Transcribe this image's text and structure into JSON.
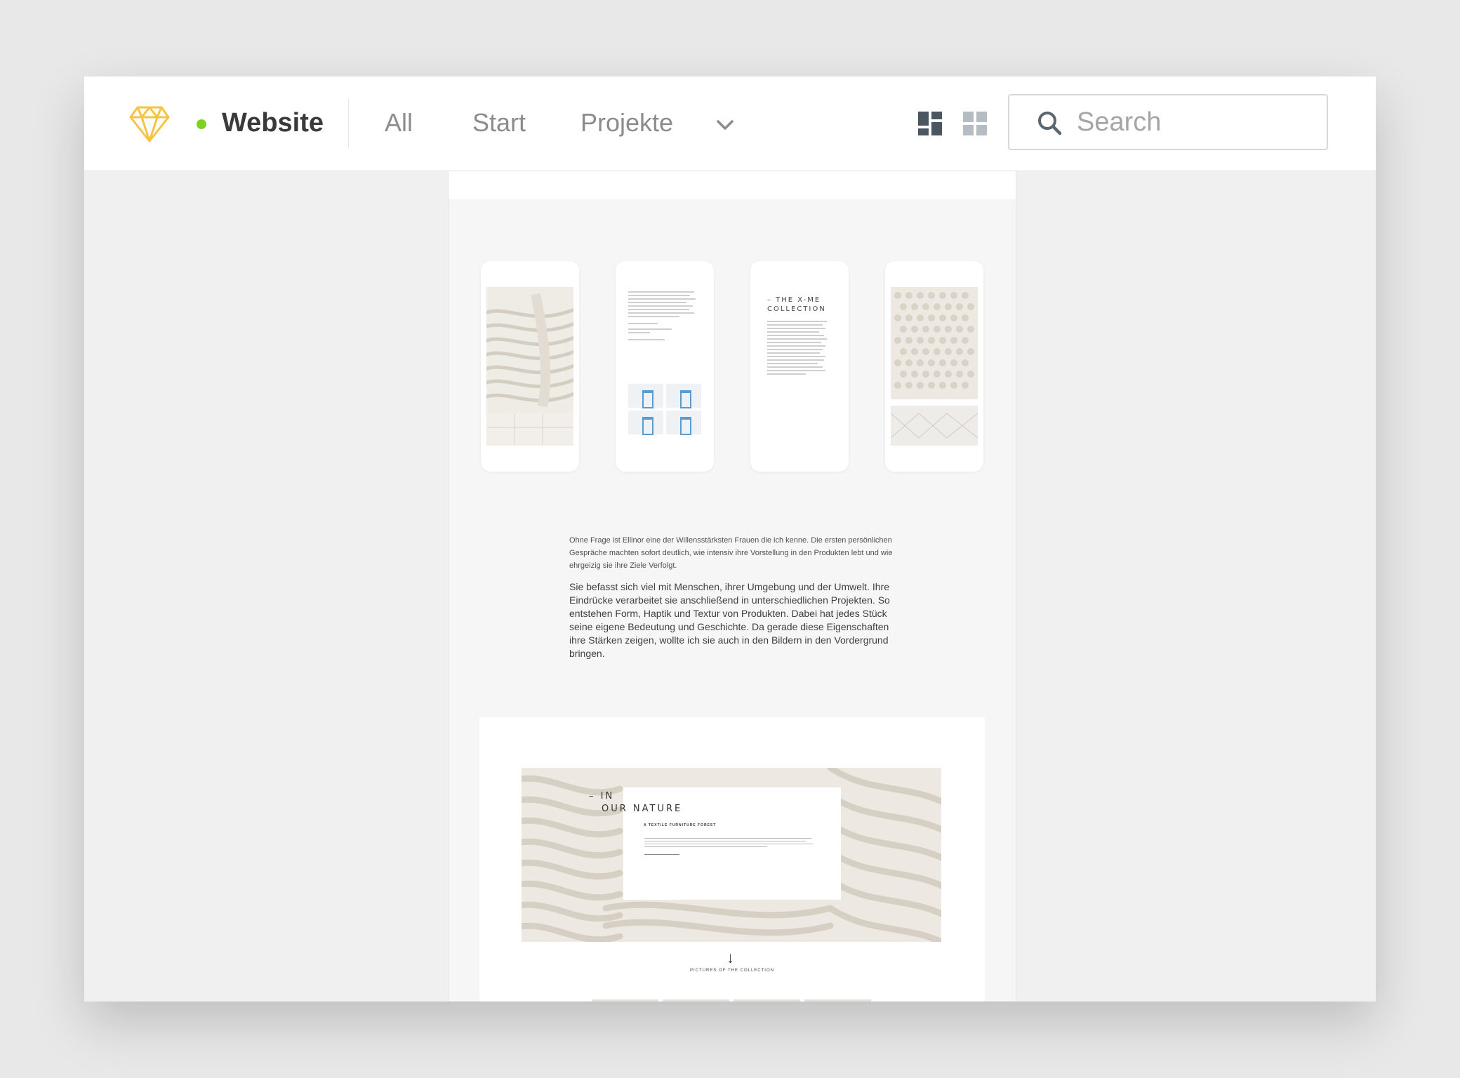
{
  "app": {
    "project_name": "Website",
    "status_color": "#7ed321",
    "logo_icon": "sketch-diamond-icon",
    "accent_color": "#f6c343"
  },
  "nav": {
    "tabs": [
      {
        "label": "All"
      },
      {
        "label": "Start"
      },
      {
        "label": "Projekte"
      }
    ],
    "more_icon": "chevron-down-icon"
  },
  "view_toggle": {
    "layout_icon": "dashboard-layout-icon",
    "grid_icon": "grid-icon"
  },
  "search": {
    "placeholder": "Search",
    "icon": "search-icon"
  },
  "preview": {
    "phone_3_title": "– THE X-ME COLLECTION",
    "intro_small": "Ohne Frage ist Ellinor eine der Willensstärksten Frauen die ich kenne. Die ersten persönlichen Gespräche machten sofort deutlich, wie intensiv ihre Vorstellung in den Produkten lebt und wie ehrgeizig sie ihre Ziele Verfolgt.",
    "intro_large": "Sie befasst sich viel mit Menschen, ihrer Umgebung und der Umwelt. Ihre Eindrücke verarbeitet sie anschließend in unterschiedlichen Projekten. So entstehen Form, Haptik und Textur von Produkten. Dabei hat jedes Stück seine eigene Bedeutung und Geschichte. Da gerade diese Eigenschaften ihre Stärken zeigen, wollte ich sie auch in den Bildern in den Vordergrund bringen.",
    "hero_in": "– IN",
    "hero_nature": "OUR NATURE",
    "hero_subtitle": "A TEXTILE FURNITURE FOREST",
    "scroll_arrow": "↓",
    "pictures_label": "PICTURES OF THE COLLECTION"
  }
}
